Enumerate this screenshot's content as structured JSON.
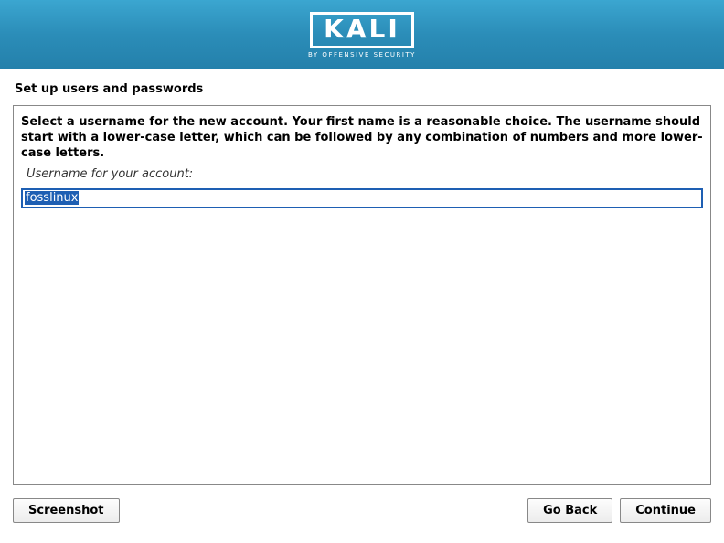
{
  "header": {
    "logo_text": "KALI",
    "logo_subtitle": "BY OFFENSIVE SECURITY"
  },
  "page_title": "Set up users and passwords",
  "content": {
    "instruction": "Select a username for the new account. Your first name is a reasonable choice. The username should start with a lower-case letter, which can be followed by any combination of numbers and more lower-case letters.",
    "field_label": "Username for your account:",
    "username_value": "fosslinux"
  },
  "buttons": {
    "screenshot": "Screenshot",
    "go_back": "Go Back",
    "continue": "Continue"
  }
}
